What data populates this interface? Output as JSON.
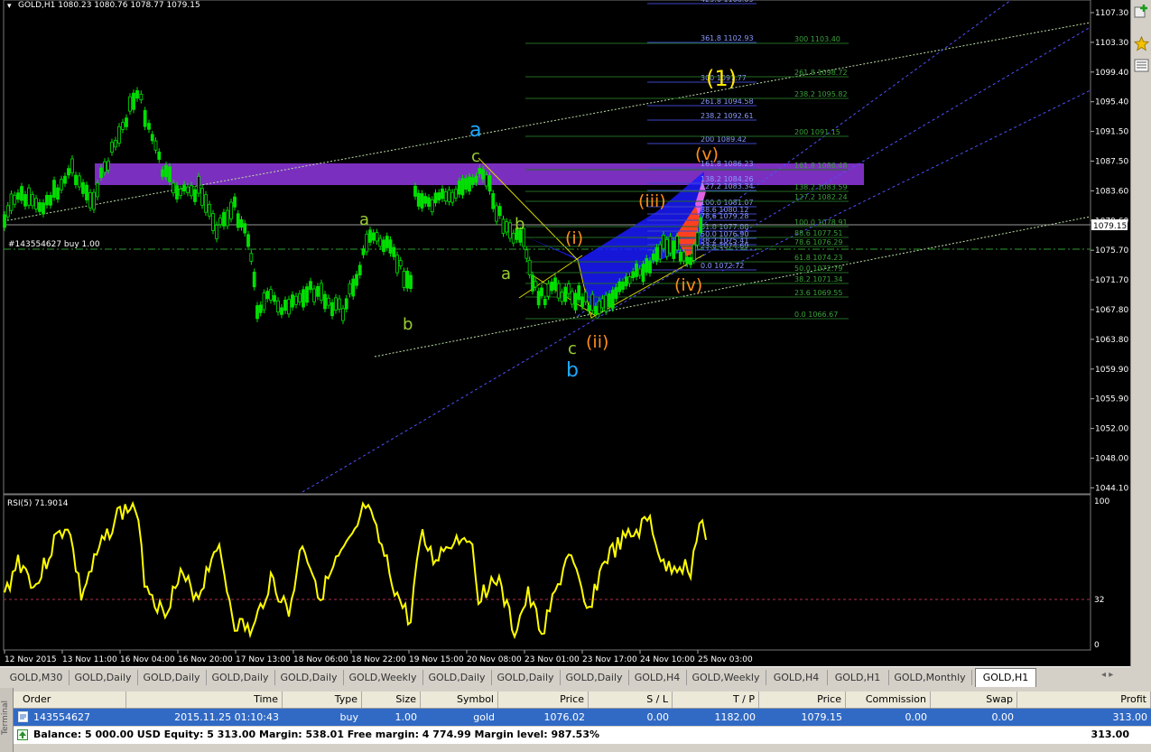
{
  "chart": {
    "header": "GOLD,H1  1080.23 1080.76 1078.77 1079.15",
    "order_line_label": "#143554627 buy 1.00",
    "current_price": "1079.15",
    "price_axis": [
      "1107.30",
      "1103.30",
      "1099.40",
      "1095.40",
      "1091.50",
      "1087.50",
      "1083.60",
      "1079.60",
      "1075.70",
      "1071.70",
      "1067.80",
      "1063.80",
      "1059.90",
      "1055.90",
      "1052.00",
      "1048.00",
      "1044.10"
    ],
    "time_axis": [
      "12 Nov 2015",
      "13 Nov 11:00",
      "16 Nov 04:00",
      "16 Nov 20:00",
      "17 Nov 13:00",
      "18 Nov 06:00",
      "18 Nov 22:00",
      "19 Nov 15:00",
      "20 Nov 08:00",
      "23 Nov 01:00",
      "23 Nov 17:00",
      "24 Nov 10:00",
      "25 Nov 03:00"
    ],
    "fib_blue": [
      "423.6 1108.09",
      "361.8 1102.93",
      "300 1097.77",
      "261.8 1094.58",
      "238.2 1092.61",
      "200 1089.42",
      "161.8 1086.23",
      "138.2 1084.26",
      "127.2 1083.34",
      "100.0 1081.07",
      "88.6 1080.12",
      "78.6 1079.28",
      "61.8 1077.88",
      "50.0 1076.90",
      "38.2 1075.41",
      "23.6 1074.69",
      "0.0 1072.72"
    ],
    "fib_green": [
      "300 1103.40",
      "261.8 1098.72",
      "238.2 1095.82",
      "200 1091.15",
      "161.8 1086.48",
      "138.2 1083.59",
      "127.2 1082.24",
      "100.0 1078.91",
      "88.6 1077.51",
      "78.6 1076.29",
      "61.8 1074.23",
      "50.0 1072.79",
      "38.2 1071.34",
      "23.6 1069.55",
      "0.0 1066.67"
    ],
    "wave_labels": {
      "w1": "(1)",
      "a_blue": "a",
      "b_blue": "b",
      "c_green": "c",
      "a_green1": "a",
      "b_green1": "b",
      "a_green2": "a",
      "b_green2": "b",
      "c_green2": "c",
      "i": "(i)",
      "ii": "(ii)",
      "iii": "(iii)",
      "iv": "(iv)",
      "v": "(v)"
    },
    "colors": {
      "background": "#000000",
      "candles": "#00ff00",
      "rsi_line": "#ffff00",
      "zone": "#7b2fbe",
      "pattern": "#1a1aff",
      "fib_blue": "#6f7fff",
      "fib_green": "#2e8b2e"
    }
  },
  "rsi": {
    "label": "RSI(5) 71.9014",
    "levels": [
      "100",
      "32",
      "0"
    ]
  },
  "chart_data": [
    {
      "type": "line",
      "title": "RSI(5) 71.9014",
      "ylim": [
        0,
        100
      ],
      "x": [
        "12 Nov 2015",
        "13 Nov 11:00",
        "16 Nov 04:00",
        "16 Nov 20:00",
        "17 Nov 13:00",
        "18 Nov 06:00",
        "18 Nov 22:00",
        "19 Nov 15:00",
        "20 Nov 08:00",
        "23 Nov 01:00",
        "23 Nov 17:00",
        "24 Nov 10:00",
        "25 Nov 03:00"
      ],
      "series": [
        {
          "name": "RSI(5)",
          "values": [
            45,
            60,
            80,
            35,
            20,
            55,
            90,
            30,
            70,
            15,
            40,
            78,
            72
          ]
        }
      ]
    }
  ],
  "tabs": [
    "GOLD,M30",
    "GOLD,Daily",
    "GOLD,Daily",
    "GOLD,Daily",
    "GOLD,Daily",
    "GOLD,Weekly",
    "GOLD,Daily",
    "GOLD,Daily",
    "GOLD,Daily",
    "GOLD,H4",
    "GOLD,Weekly",
    "GOLD,H4",
    "GOLD,H1",
    "GOLD,Monthly",
    "GOLD,H1"
  ],
  "active_tab": "GOLD,H1",
  "terminal": {
    "side_label": "Terminal",
    "headers": [
      "Order",
      "Time",
      "Type",
      "Size",
      "Symbol",
      "Price",
      "S / L",
      "T / P",
      "Price",
      "Commission",
      "Swap",
      "Profit"
    ],
    "row": [
      "143554627",
      "2015.11.25 01:10:43",
      "buy",
      "1.00",
      "gold",
      "1076.02",
      "0.00",
      "1182.00",
      "1079.15",
      "0.00",
      "0.00",
      "313.00"
    ],
    "balance": "Balance: 5 000.00 USD  Equity: 5 313.00  Margin: 538.01  Free margin: 4 774.99  Margin level: 987.53%",
    "balance_total": "313.00"
  }
}
